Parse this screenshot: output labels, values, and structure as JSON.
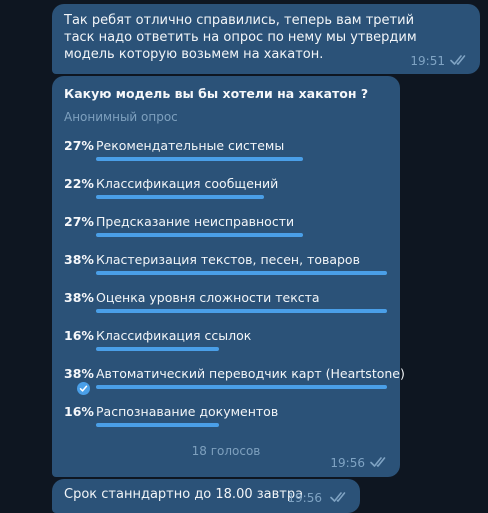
{
  "messages": [
    {
      "text": "Так ребят отлично справились, теперь вам третий таск надо ответить на опрос по нему мы утвердим модель которую возьмем на хакатон.",
      "time": "19:51"
    }
  ],
  "poll": {
    "question": "Какую модель вы бы хотели на хакатон ?",
    "type": "Анонимный опрос",
    "options": [
      {
        "percent": "27%",
        "label": "Рекомендательные системы",
        "value": 27,
        "voted": false
      },
      {
        "percent": "22%",
        "label": "Классификация сообщений",
        "value": 22,
        "voted": false
      },
      {
        "percent": "27%",
        "label": "Предсказание неисправности",
        "value": 27,
        "voted": false
      },
      {
        "percent": "38%",
        "label": "Кластеризация текстов, песен, товаров",
        "value": 38,
        "voted": false
      },
      {
        "percent": "38%",
        "label": "Оценка уровня сложности текста",
        "value": 38,
        "voted": false
      },
      {
        "percent": "16%",
        "label": "Классификация ссылок",
        "value": 16,
        "voted": false
      },
      {
        "percent": "38%",
        "label": "Автоматический переводчик карт (Heartstone)",
        "value": 38,
        "voted": true
      },
      {
        "percent": "16%",
        "label": "Распознавание документов",
        "value": 16,
        "voted": false
      }
    ],
    "total_votes": "18 голосов",
    "time": "19:56"
  },
  "last_message": {
    "text": "Срок станндартно до 18.00 завтра",
    "time": "19:56"
  },
  "colors": {
    "background": "#0e1621",
    "bubble": "#2b5278",
    "bar": "#4a9fe8",
    "meta": "#7fa3c3"
  },
  "icons": {
    "read_receipt": "double-check-icon",
    "vote_mark": "check-circle-icon"
  }
}
